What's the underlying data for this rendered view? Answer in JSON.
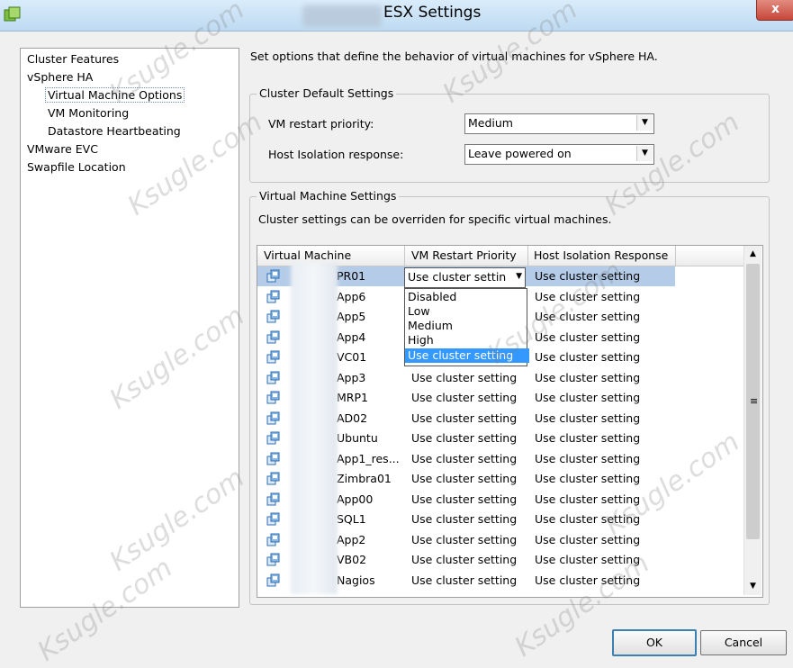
{
  "window": {
    "title": "ESX Settings",
    "close": "x"
  },
  "nav": {
    "items": [
      {
        "label": "Cluster Features"
      },
      {
        "label": "vSphere HA"
      },
      {
        "label": "Virtual Machine Options"
      },
      {
        "label": "VM Monitoring"
      },
      {
        "label": "Datastore Heartbeating"
      },
      {
        "label": "VMware EVC"
      },
      {
        "label": "Swapfile Location"
      }
    ]
  },
  "intro": "Set options that define the behavior of virtual machines for vSphere HA.",
  "cluster_defaults": {
    "group_label": "Cluster Default Settings",
    "restart_label": "VM restart priority:",
    "restart_value": "Medium",
    "isolation_label": "Host Isolation response:",
    "isolation_value": "Leave powered on"
  },
  "vm_settings": {
    "group_label": "Virtual Machine Settings",
    "description": "Cluster settings can be overriden for specific virtual machines.",
    "columns": [
      "Virtual Machine",
      "VM Restart Priority",
      "Host Isolation Response"
    ],
    "rows": [
      {
        "name": "PR01",
        "priority": "Use cluster setting",
        "isolation": "Use cluster setting"
      },
      {
        "name": "App6",
        "priority": "",
        "isolation": "Use cluster setting"
      },
      {
        "name": "App5",
        "priority": "",
        "isolation": "Use cluster setting"
      },
      {
        "name": "App4",
        "priority": "",
        "isolation": "Use cluster setting"
      },
      {
        "name": "VC01",
        "priority": "",
        "isolation": "Use cluster setting"
      },
      {
        "name": "App3",
        "priority": "Use cluster setting",
        "isolation": "Use cluster setting"
      },
      {
        "name": "MRP1",
        "priority": "Use cluster setting",
        "isolation": "Use cluster setting"
      },
      {
        "name": "AD02",
        "priority": "Use cluster setting",
        "isolation": "Use cluster setting"
      },
      {
        "name": "Ubuntu",
        "priority": "Use cluster setting",
        "isolation": "Use cluster setting"
      },
      {
        "name": "App1_res...",
        "priority": "Use cluster setting",
        "isolation": "Use cluster setting"
      },
      {
        "name": "Zimbra01",
        "priority": "Use cluster setting",
        "isolation": "Use cluster setting"
      },
      {
        "name": "App00",
        "priority": "Use cluster setting",
        "isolation": "Use cluster setting"
      },
      {
        "name": "SQL1",
        "priority": "Use cluster setting",
        "isolation": "Use cluster setting"
      },
      {
        "name": "App2",
        "priority": "Use cluster setting",
        "isolation": "Use cluster setting"
      },
      {
        "name": "VB02",
        "priority": "Use cluster setting",
        "isolation": "Use cluster setting"
      },
      {
        "name": "Nagios",
        "priority": "Use cluster setting",
        "isolation": "Use cluster setting"
      }
    ],
    "inline_select_value": "Use cluster setting",
    "dropdown_options": [
      "Disabled",
      "Low",
      "Medium",
      "High",
      "Use cluster setting"
    ],
    "dropdown_highlighted": "Use cluster setting"
  },
  "buttons": {
    "ok": "OK",
    "cancel": "Cancel"
  },
  "watermark": "Ksugle.com",
  "colors": {
    "selection": "#b5cce8",
    "highlight": "#3399ff",
    "close": "#c7473a"
  }
}
